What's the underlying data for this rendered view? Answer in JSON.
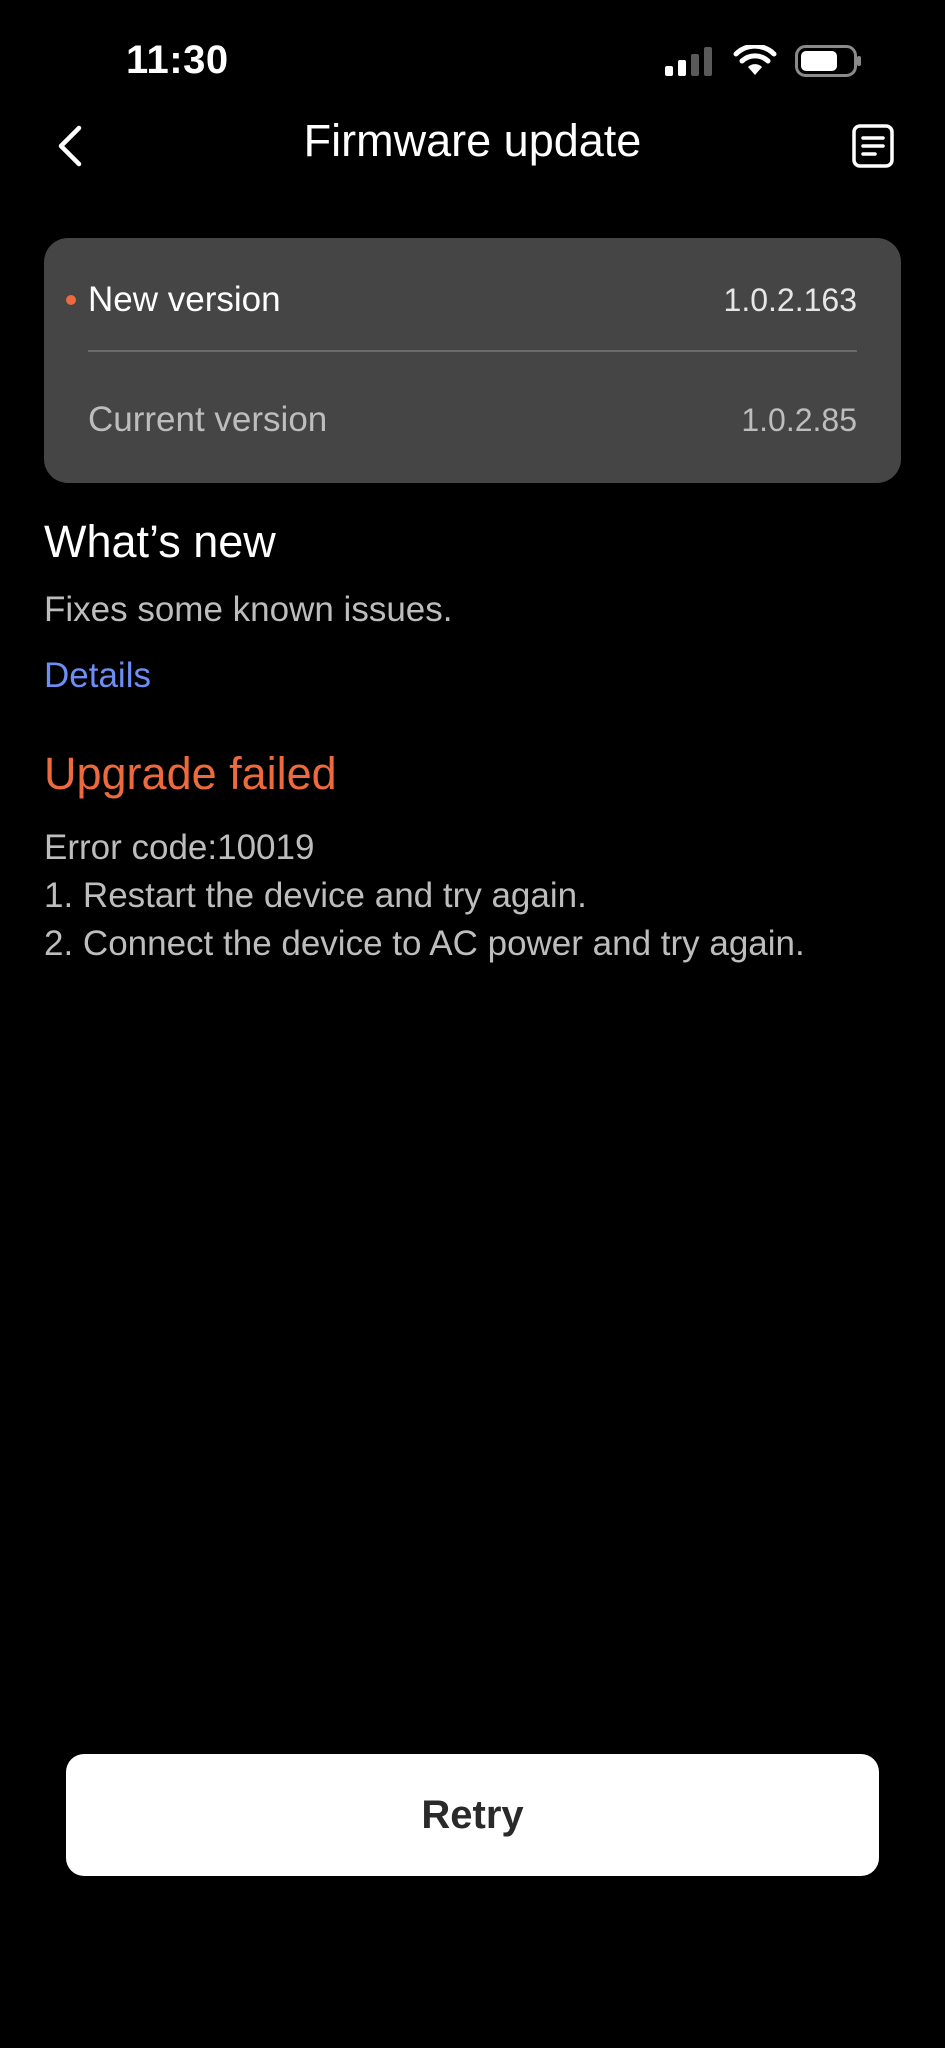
{
  "status_bar": {
    "time": "11:30",
    "icons": [
      "cellular-signal-icon",
      "wifi-icon",
      "battery-icon"
    ]
  },
  "header": {
    "title": "Firmware update",
    "back_icon": "chevron-left-icon",
    "log_icon": "document-list-icon"
  },
  "versions": {
    "new_label": "New version",
    "new_value": "1.0.2.163",
    "current_label": "Current version",
    "current_value": "1.0.2.85"
  },
  "whats_new": {
    "title": "What’s new",
    "description": "Fixes some known issues.",
    "details_link": "Details"
  },
  "error": {
    "title": "Upgrade failed",
    "lines": [
      "Error code:10019",
      "1. Restart the device and try again.",
      "2. Connect the device to AC power and try again."
    ]
  },
  "retry_button": "Retry",
  "colors": {
    "background": "#000000",
    "card": "#454545",
    "accent_orange": "#ec6a3d",
    "link_blue": "#6d8ef5",
    "secondary_text": "#bdbdbd"
  }
}
